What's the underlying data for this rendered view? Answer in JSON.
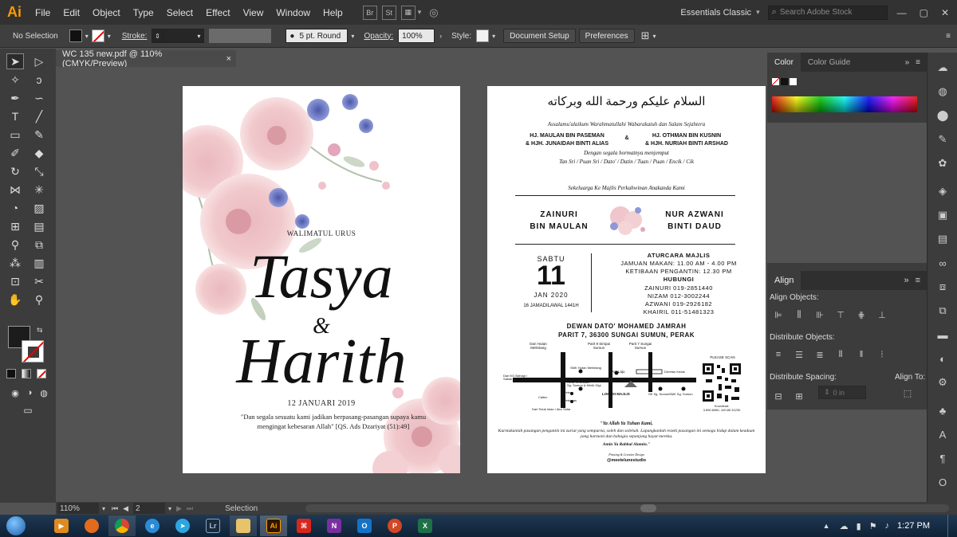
{
  "menubar": {
    "logo": "Ai",
    "menus": [
      "File",
      "Edit",
      "Object",
      "Type",
      "Select",
      "Effect",
      "View",
      "Window",
      "Help"
    ],
    "bridge": "Br",
    "stock": "St",
    "workspace": "Essentials Classic",
    "search_placeholder": "Search Adobe Stock"
  },
  "controlbar": {
    "selection": "No Selection",
    "stroke_label": "Stroke:",
    "brush": "5 pt. Round",
    "opacity_label": "Opacity:",
    "opacity_value": "100%",
    "style_label": "Style:",
    "document_setup": "Document Setup",
    "preferences": "Preferences"
  },
  "document": {
    "tab_title": "WC 135 new.pdf @ 110% (CMYK/Preview)",
    "close": "×"
  },
  "left_page": {
    "walimatul": "WALIMATUL URUS",
    "name1": "Tasya",
    "amp": "&",
    "name2": "Harith",
    "date": "12 JANUARI 2019",
    "quote": "\"Dan segala sesuatu kami jadikan berpasang-pasangan supaya kamu mengingat kebesaran Allah\" [QS. Ads Dzariyat (51):49]"
  },
  "right_page": {
    "arabic": "السلام عليكم ورحمة الله وبركاته",
    "greeting": "Assalamu'alaikum Warahmatullahi Wabarakatuh dan Salam Sejahtera",
    "host_left_1": "HJ. MAULAN BIN PASEMAN",
    "host_left_2": "& HJH. JUNAIDAH BINTI ALIAS",
    "host_amp": "&",
    "host_right_1": "HJ. OTHMAN BIN KUSNIN",
    "host_right_2": "& HJH. NURIAH BINTI ARSHAD",
    "respect": "Dengan segala hormatnya menjemput",
    "titles": "Tan Sri / Puan Sri / Dato' / Datin / Tuan / Puan / Encik / Cik",
    "invite": "Sekeluarga Ke Majlis Perkahwinan Anakanda Kami",
    "groom_1": "ZAINURI",
    "groom_2": "BIN MAULAN",
    "bride_1": "NUR AZWANI",
    "bride_2": "BINTI DAUD",
    "day": "SABTU",
    "date_num": "11",
    "month_year": "JAN 2020",
    "hijri": "16 JAMADILAWAL 1441H",
    "aturcara_title": "ATURCARA MAJLIS",
    "jamuan": "JAMUAN MAKAN: 11.00 AM - 4.00 PM",
    "ketibaan": "KETIBAAN PENGANTIN: 12.30 PM",
    "hubungi_title": "HUBUNGI",
    "contact_1": "ZAINURI 019-2851440",
    "contact_2": "NIZAM 012-3002244",
    "contact_3": "AZWANI 019-2926182",
    "contact_4": "KHAIRIL 011-51481323",
    "venue_1": "DEWAN DATO' MOHAMED JAMRAH",
    "venue_2": "PARIT 7, 36300 SUNGAI SUMUN, PERAK",
    "map_labels": {
      "dari_hutan": "Dari Hutan Melintang",
      "parit9": "Parit 9 Simpai Sumun",
      "parit7": "Parit 7 Sungai Sumun",
      "please_scan": "PLEASE SCAN",
      "dari_kg": "Dari KG.Bahagi / Sabak Bernam",
      "smk": "SMK Hutan Melintang",
      "pos": "Pos Laju",
      "deretan": "Deretan Kedai",
      "bandar": "Dari Bandar Baru Teluk Intan",
      "klinik1": "Klinik Kesihatan",
      "klinik2": "Sg. Sumun & Klinik Gigi",
      "caltex": "Caltex",
      "petron": "Petron",
      "petronas": "Petronas",
      "lokasi": "LOKASI MAJLIS",
      "sk": "SK Sg. Sumun",
      "smk_sg": "SMK Sg. Sumun",
      "koordinat": "Koordinat:",
      "coords": "3.890.6980, 100.85 31230",
      "dari_teluk": "Dari Teluk Intan / Alor Setar"
    },
    "doa_1": "\"Ya Allah Ya Tuhan Kami,",
    "doa_2": "Kurniakanlah pasangan pengantin ini zuriat yang sempurna, soleh dan solehah. Lapangkanlah rezeki pasangan ini semoga hidup dalam keadaan yang harmoni dan bahagia sepanjang hayat mereka.",
    "doa_3": "Amin Ya Rabbal Alamin.\"",
    "credit_1": "Printing & Creative Design",
    "credit_2": "@meetelunestudio"
  },
  "color_panel": {
    "tab_color": "Color",
    "tab_guide": "Color Guide"
  },
  "align_panel": {
    "title": "Align",
    "align_objects": "Align Objects:",
    "distribute_objects": "Distribute Objects:",
    "distribute_spacing": "Distribute Spacing:",
    "align_to": "Align To:",
    "spacing_value": "0 in"
  },
  "statusbar": {
    "zoom": "110%",
    "page": "2",
    "tool": "Selection"
  },
  "taskbar": {
    "time": "1:27 PM"
  }
}
